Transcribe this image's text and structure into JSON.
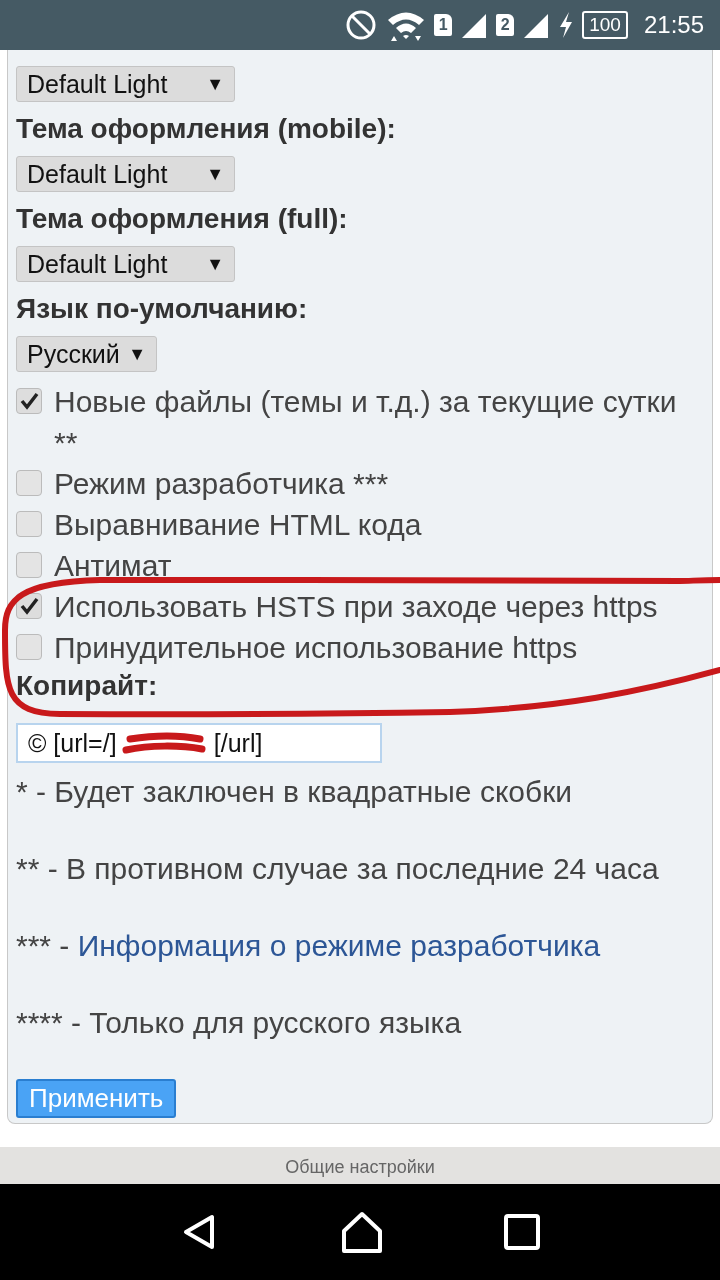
{
  "status_bar": {
    "sim_1": "1",
    "sim_2": "2",
    "battery": "100",
    "time": "21:55"
  },
  "settings": [
    {
      "kind": "select",
      "value": "Default Light",
      "arrow": "▼"
    },
    {
      "kind": "label",
      "text": "Тема оформления (mobile):"
    },
    {
      "kind": "select",
      "value": "Default Light",
      "arrow": "▼"
    },
    {
      "kind": "label",
      "text": "Тема оформления (full):"
    },
    {
      "kind": "select",
      "value": "Default Light",
      "arrow": "▼"
    },
    {
      "kind": "label",
      "text": "Язык по-умолчанию:"
    },
    {
      "kind": "select",
      "value": "Русский",
      "arrow": "▼"
    },
    {
      "kind": "checkbox",
      "text": "Новые файлы (темы и т.д.) за текущие сутки **",
      "checked": true
    },
    {
      "kind": "checkbox",
      "text": "Режим разработчика ***",
      "checked": false
    },
    {
      "kind": "checkbox",
      "text": "Выравнивание HTML кода",
      "checked": false
    },
    {
      "kind": "checkbox",
      "text": "Антимат",
      "checked": false
    },
    {
      "kind": "checkbox",
      "text": "Использовать HSTS при заходе через https",
      "checked": true
    },
    {
      "kind": "checkbox",
      "text": "Принудительное использование https",
      "checked": false
    },
    {
      "kind": "label",
      "text": "Копирайт:"
    },
    {
      "kind": "input",
      "value": "© [url=/]              [/url]"
    },
    {
      "kind": "note",
      "text": "* - Будет заключен в квадратные скобки"
    },
    {
      "kind": "note",
      "text": "** - В противном случае за последние 24 часа"
    },
    {
      "kind": "note",
      "text": "*** - ",
      "link": "Информация о режиме разработчика"
    },
    {
      "kind": "note",
      "text": "**** - Только для русского языка"
    }
  ],
  "apply_button": "Применить",
  "footer": "Общие настройки"
}
